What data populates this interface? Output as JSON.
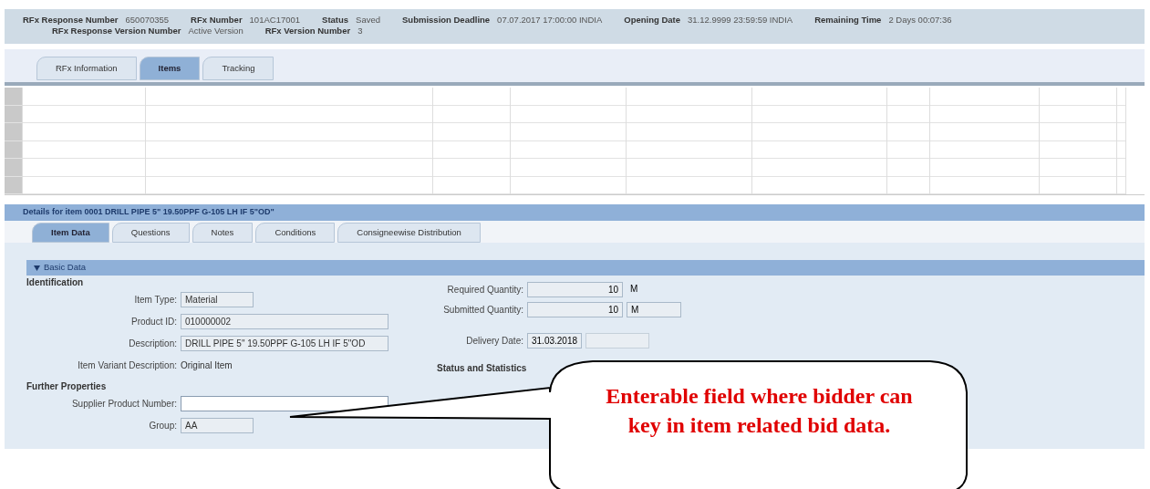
{
  "header": {
    "row1": [
      {
        "label": "RFx Response Number",
        "value": "650070355"
      },
      {
        "label": "RFx Number",
        "value": "101AC17001"
      },
      {
        "label": "Status",
        "value": "Saved"
      },
      {
        "label": "Submission Deadline",
        "value": "07.07.2017 17:00:00 INDIA"
      },
      {
        "label": "Opening Date",
        "value": "31.12.9999 23:59:59 INDIA"
      },
      {
        "label": "Remaining Time",
        "value": "2 Days 00:07:36"
      }
    ],
    "row2": [
      {
        "label": "RFx Response Version Number",
        "value": "Active Version"
      },
      {
        "label": "RFx Version Number",
        "value": "3"
      }
    ]
  },
  "tabs": [
    {
      "label": "RFx Information",
      "selected": false
    },
    {
      "label": "Items",
      "selected": true
    },
    {
      "label": "Tracking",
      "selected": false
    }
  ],
  "details_title": "Details for item 0001 DRILL PIPE 5\" 19.50PPF G-105 LH IF 5\"OD\"",
  "sub_tabs": [
    {
      "label": "Item Data",
      "selected": true
    },
    {
      "label": "Questions",
      "selected": false
    },
    {
      "label": "Notes",
      "selected": false
    },
    {
      "label": "Conditions",
      "selected": false
    },
    {
      "label": "Consigneewise Distribution",
      "selected": false
    }
  ],
  "section": {
    "title": "Basic Data",
    "expanded": true
  },
  "identification": {
    "title": "Identification",
    "fields": [
      {
        "label": "Item Type:",
        "value": "Material",
        "kind": "short"
      },
      {
        "label": "Product ID:",
        "value": "010000002",
        "kind": "long"
      },
      {
        "label": "Description:",
        "value": "DRILL PIPE 5\" 19.50PPF G-105 LH IF 5\"OD",
        "kind": "long"
      },
      {
        "label": "Item Variant Description:",
        "value": "Original Item",
        "kind": "text"
      }
    ]
  },
  "further": {
    "title": "Further Properties",
    "fields": [
      {
        "label": "Supplier Product Number:",
        "kind": "editable"
      },
      {
        "label": "Group:",
        "value": "AA",
        "kind": "short"
      }
    ]
  },
  "quantities": [
    {
      "label": "Required Quantity:",
      "value": "10",
      "unit": "M",
      "unit_boxed": false
    },
    {
      "label": "Submitted Quantity:",
      "value": "10",
      "unit": "M",
      "unit_boxed": true
    }
  ],
  "delivery": {
    "label": "Delivery Date:",
    "date": "31.03.2018"
  },
  "status_title": "Status and Statistics",
  "callout": "Enterable field where bidder can key in item related bid data."
}
